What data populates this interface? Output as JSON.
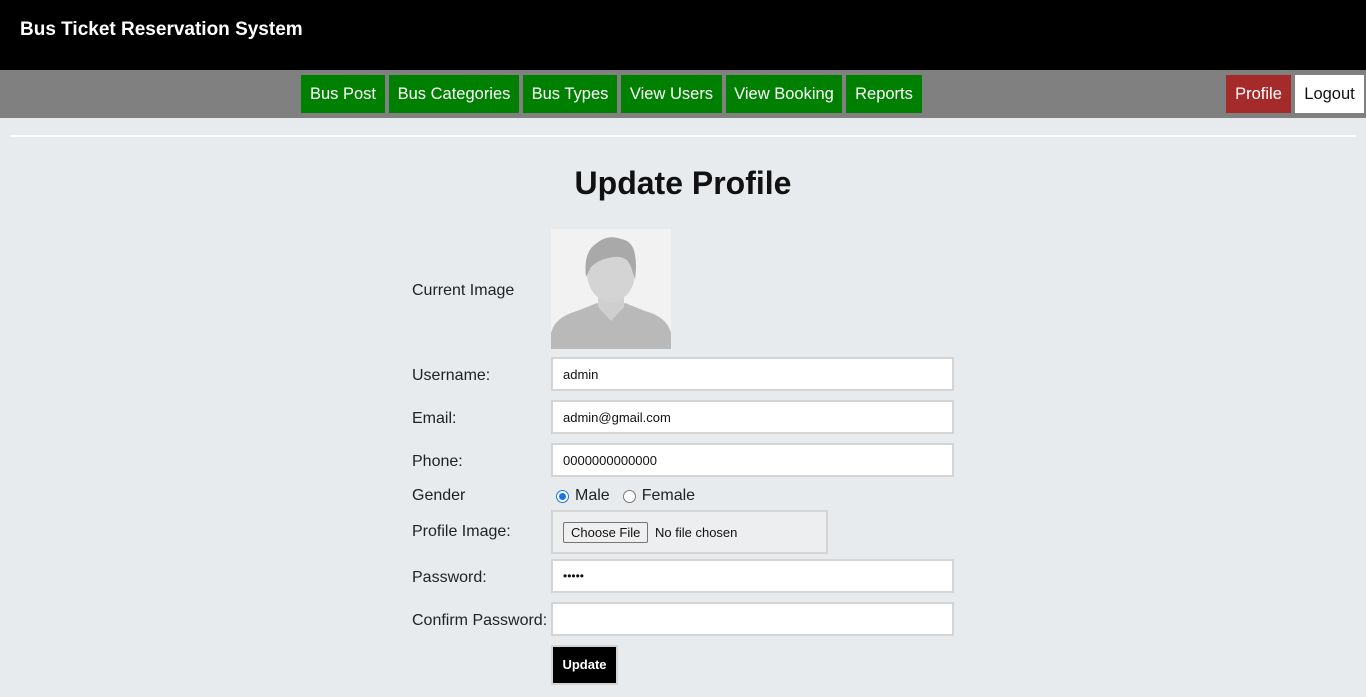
{
  "header": {
    "title": "Bus Ticket Reservation System"
  },
  "nav": {
    "items": [
      {
        "label": "Bus Post"
      },
      {
        "label": "Bus Categories"
      },
      {
        "label": "Bus Types"
      },
      {
        "label": "View Users"
      },
      {
        "label": "View Booking"
      },
      {
        "label": "Reports"
      }
    ],
    "profile_label": "Profile",
    "logout_label": "Logout"
  },
  "form": {
    "title": "Update Profile",
    "current_image_label": "Current Image",
    "avatar_icon": "user-silhouette-icon",
    "username_label": "Username:",
    "username_value": "admin",
    "email_label": "Email:",
    "email_value": "admin@gmail.com",
    "phone_label": "Phone:",
    "phone_value": "0000000000000",
    "gender_label": "Gender",
    "gender_options": [
      {
        "label": "Male",
        "selected": true
      },
      {
        "label": "Female",
        "selected": false
      }
    ],
    "profile_image_label": "Profile Image:",
    "choose_file_label": "Choose File",
    "file_status": "No file chosen",
    "password_label": "Password:",
    "password_value": "•••••",
    "confirm_password_label": "Confirm Password:",
    "confirm_password_value": "",
    "update_label": "Update"
  },
  "colors": {
    "header_bg": "#000000",
    "navbar_bg": "#808080",
    "nav_item_bg": "#008000",
    "profile_bg": "#a52a2a",
    "page_bg": "#e8ebee"
  }
}
